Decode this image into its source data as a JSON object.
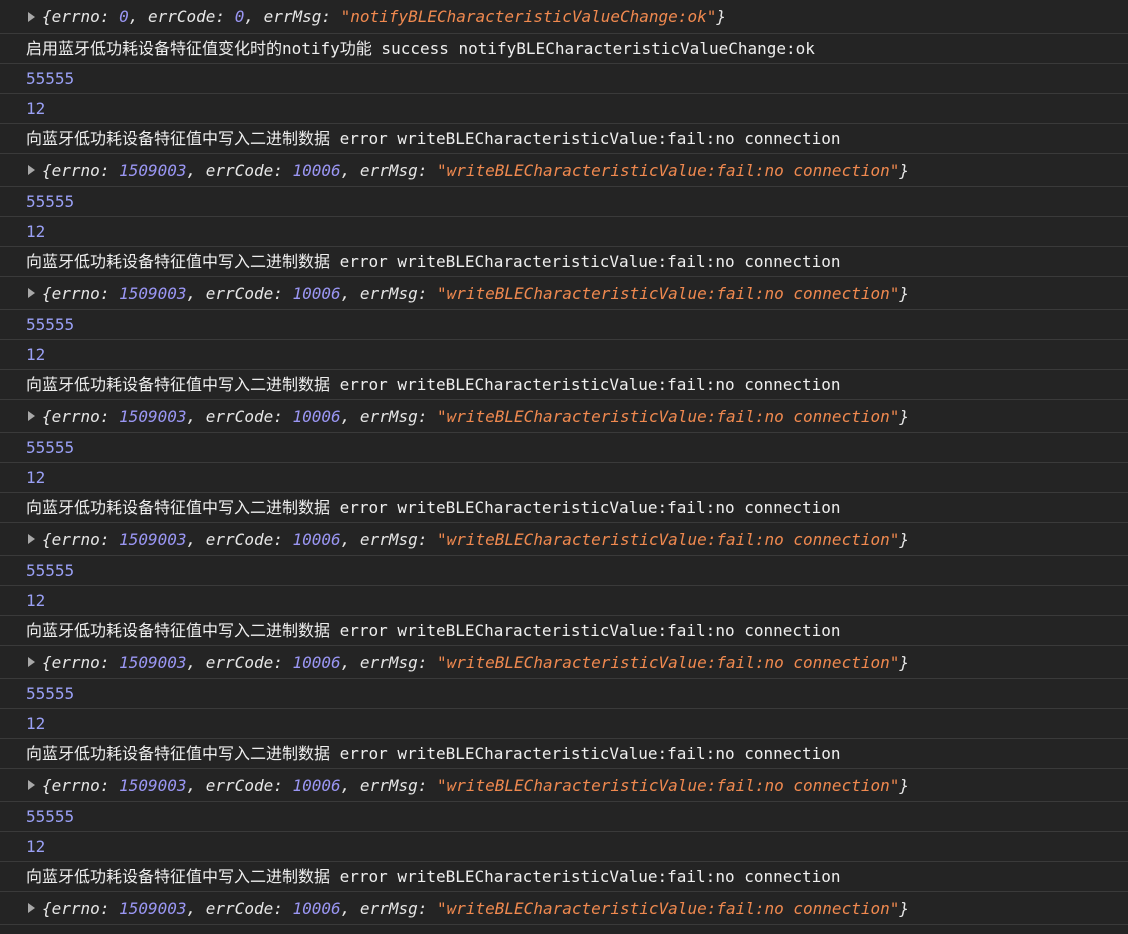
{
  "first_object": {
    "errno": "0",
    "errCode": "0",
    "errMsg": "\"notifyBLECharacteristicValueChange:ok\""
  },
  "notify_message": "启用蓝牙低功耗设备特征值变化时的notify功能 success notifyBLECharacteristicValueChange:ok",
  "keys": {
    "errno": "errno",
    "errCode": "errCode",
    "errMsg": "errMsg"
  },
  "groups": [
    {
      "value_a": "55555",
      "value_b": "12",
      "error_message": "向蓝牙低功耗设备特征值中写入二进制数据 error writeBLECharacteristicValue:fail:no connection",
      "errno": "1509003",
      "errCode": "10006",
      "errMsg": "\"writeBLECharacteristicValue:fail:no connection\""
    },
    {
      "value_a": "55555",
      "value_b": "12",
      "error_message": "向蓝牙低功耗设备特征值中写入二进制数据 error writeBLECharacteristicValue:fail:no connection",
      "errno": "1509003",
      "errCode": "10006",
      "errMsg": "\"writeBLECharacteristicValue:fail:no connection\""
    },
    {
      "value_a": "55555",
      "value_b": "12",
      "error_message": "向蓝牙低功耗设备特征值中写入二进制数据 error writeBLECharacteristicValue:fail:no connection",
      "errno": "1509003",
      "errCode": "10006",
      "errMsg": "\"writeBLECharacteristicValue:fail:no connection\""
    },
    {
      "value_a": "55555",
      "value_b": "12",
      "error_message": "向蓝牙低功耗设备特征值中写入二进制数据 error writeBLECharacteristicValue:fail:no connection",
      "errno": "1509003",
      "errCode": "10006",
      "errMsg": "\"writeBLECharacteristicValue:fail:no connection\""
    },
    {
      "value_a": "55555",
      "value_b": "12",
      "error_message": "向蓝牙低功耗设备特征值中写入二进制数据 error writeBLECharacteristicValue:fail:no connection",
      "errno": "1509003",
      "errCode": "10006",
      "errMsg": "\"writeBLECharacteristicValue:fail:no connection\""
    },
    {
      "value_a": "55555",
      "value_b": "12",
      "error_message": "向蓝牙低功耗设备特征值中写入二进制数据 error writeBLECharacteristicValue:fail:no connection",
      "errno": "1509003",
      "errCode": "10006",
      "errMsg": "\"writeBLECharacteristicValue:fail:no connection\""
    },
    {
      "value_a": "55555",
      "value_b": "12",
      "error_message": "向蓝牙低功耗设备特征值中写入二进制数据 error writeBLECharacteristicValue:fail:no connection",
      "errno": "1509003",
      "errCode": "10006",
      "errMsg": "\"writeBLECharacteristicValue:fail:no connection\""
    }
  ]
}
